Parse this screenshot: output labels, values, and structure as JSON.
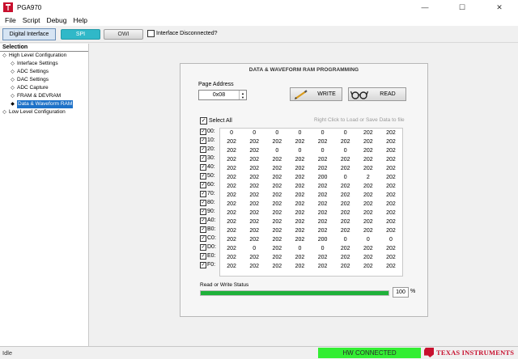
{
  "window": {
    "title": "PGA970",
    "controls": [
      "—",
      "☐",
      "✕"
    ]
  },
  "menu": [
    "File",
    "Script",
    "Debug",
    "Help"
  ],
  "toolbar": {
    "digital_interface": "Digital Interface",
    "spi": "SPI",
    "owi": "OWI",
    "interface_disconnected": "Interface Disconnected?",
    "interface_disconnected_checked": false
  },
  "sidebar": {
    "header": "Selection",
    "items": [
      {
        "label": "High Level Configuration",
        "level": 0,
        "bullet": "◇"
      },
      {
        "label": "Interface Settings",
        "level": 1,
        "bullet": "◇"
      },
      {
        "label": "ADC Settings",
        "level": 1,
        "bullet": "◇"
      },
      {
        "label": "DAC Settings",
        "level": 1,
        "bullet": "◇"
      },
      {
        "label": "ADC Capture",
        "level": 1,
        "bullet": "◇"
      },
      {
        "label": "FRAM & DEVRAM",
        "level": 1,
        "bullet": "◇"
      },
      {
        "label": "Data & Waveform RAM",
        "level": 1,
        "bullet": "◆",
        "selected": true
      },
      {
        "label": "Low Level Configuration",
        "level": 0,
        "bullet": "◇"
      }
    ]
  },
  "panel": {
    "title": "DATA & WAVEFORM RAM PROGRAMMING",
    "page_address_label": "Page Address",
    "page_address_value": "0x08",
    "write_label": "WRITE",
    "read_label": "READ",
    "select_all_label": "Select All",
    "hint": "Right Click to Load or Save Data to file",
    "status_label": "Read or Write Status",
    "progress_percent": 100,
    "progress_text": "100",
    "progress_unit": "%"
  },
  "grid": {
    "rows": [
      {
        "addr": "00:",
        "values": [
          "0",
          "0",
          "0",
          "0",
          "0",
          "0",
          "202",
          "202"
        ]
      },
      {
        "addr": "10:",
        "values": [
          "202",
          "202",
          "202",
          "202",
          "202",
          "202",
          "202",
          "202"
        ]
      },
      {
        "addr": "20:",
        "values": [
          "202",
          "202",
          "0",
          "0",
          "0",
          "0",
          "202",
          "202"
        ]
      },
      {
        "addr": "30:",
        "values": [
          "202",
          "202",
          "202",
          "202",
          "202",
          "202",
          "202",
          "202"
        ]
      },
      {
        "addr": "40:",
        "values": [
          "202",
          "202",
          "202",
          "202",
          "202",
          "202",
          "202",
          "202"
        ]
      },
      {
        "addr": "50:",
        "values": [
          "202",
          "202",
          "202",
          "202",
          "200",
          "0",
          "2",
          "202"
        ]
      },
      {
        "addr": "60:",
        "values": [
          "202",
          "202",
          "202",
          "202",
          "202",
          "202",
          "202",
          "202"
        ]
      },
      {
        "addr": "70:",
        "values": [
          "202",
          "202",
          "202",
          "202",
          "202",
          "202",
          "202",
          "202"
        ]
      },
      {
        "addr": "80:",
        "values": [
          "202",
          "202",
          "202",
          "202",
          "202",
          "202",
          "202",
          "202"
        ]
      },
      {
        "addr": "90:",
        "values": [
          "202",
          "202",
          "202",
          "202",
          "202",
          "202",
          "202",
          "202"
        ]
      },
      {
        "addr": "A0:",
        "values": [
          "202",
          "202",
          "202",
          "202",
          "202",
          "202",
          "202",
          "202"
        ]
      },
      {
        "addr": "B0:",
        "values": [
          "202",
          "202",
          "202",
          "202",
          "202",
          "202",
          "202",
          "202"
        ]
      },
      {
        "addr": "C0:",
        "values": [
          "202",
          "202",
          "202",
          "202",
          "200",
          "0",
          "0",
          "0"
        ]
      },
      {
        "addr": "D0:",
        "values": [
          "202",
          "0",
          "202",
          "0",
          "0",
          "202",
          "202",
          "202"
        ]
      },
      {
        "addr": "E0:",
        "values": [
          "202",
          "202",
          "202",
          "202",
          "202",
          "202",
          "202",
          "202"
        ]
      },
      {
        "addr": "F0:",
        "values": [
          "202",
          "202",
          "202",
          "202",
          "202",
          "202",
          "202",
          "202"
        ]
      }
    ]
  },
  "statusbar": {
    "status": "Idle",
    "hw": "HW CONNECTED",
    "brand": "TEXAS INSTRUMENTS"
  },
  "colors": {
    "accent_spi": "#30b8c8",
    "selected": "#1e72c8",
    "progress": "#1fb13a",
    "hw_connected": "#33ee33",
    "ti_red": "#c8102e"
  }
}
